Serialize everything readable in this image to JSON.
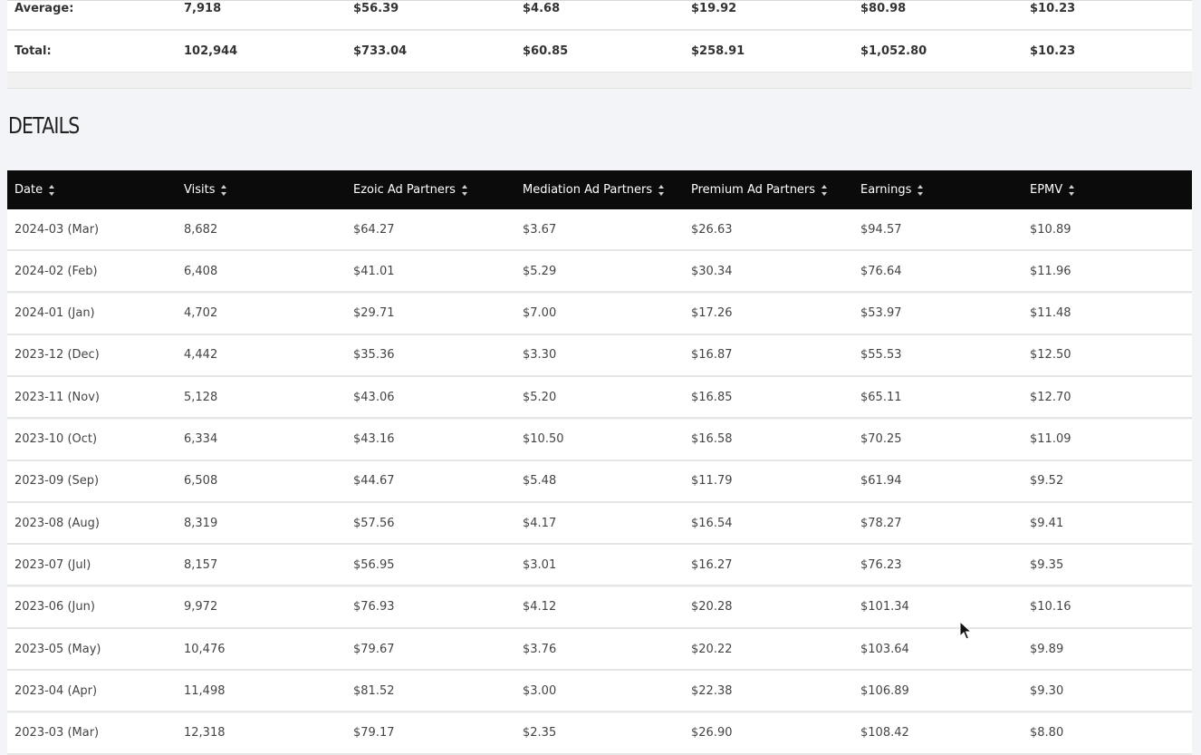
{
  "summary": {
    "average": {
      "label": "Average:",
      "visits": "7,918",
      "ezoic": "$56.39",
      "mediation": "$4.68",
      "premium": "$19.92",
      "earnings": "$80.98",
      "epmv": "$10.23"
    },
    "total": {
      "label": "Total:",
      "visits": "102,944",
      "ezoic": "$733.04",
      "mediation": "$60.85",
      "premium": "$258.91",
      "earnings": "$1,052.80",
      "epmv": "$10.23"
    }
  },
  "details": {
    "title": "DETAILS",
    "headers": {
      "date": "Date",
      "visits": "Visits",
      "ezoic": "Ezoic Ad Partners",
      "mediation": "Mediation Ad Partners",
      "premium": "Premium Ad Partners",
      "earnings": "Earnings",
      "epmv": "EPMV"
    },
    "rows": [
      {
        "date": "2024-03 (Mar)",
        "visits": "8,682",
        "ezoic": "$64.27",
        "mediation": "$3.67",
        "premium": "$26.63",
        "earnings": "$94.57",
        "epmv": "$10.89"
      },
      {
        "date": "2024-02 (Feb)",
        "visits": "6,408",
        "ezoic": "$41.01",
        "mediation": "$5.29",
        "premium": "$30.34",
        "earnings": "$76.64",
        "epmv": "$11.96"
      },
      {
        "date": "2024-01 (Jan)",
        "visits": "4,702",
        "ezoic": "$29.71",
        "mediation": "$7.00",
        "premium": "$17.26",
        "earnings": "$53.97",
        "epmv": "$11.48"
      },
      {
        "date": "2023-12 (Dec)",
        "visits": "4,442",
        "ezoic": "$35.36",
        "mediation": "$3.30",
        "premium": "$16.87",
        "earnings": "$55.53",
        "epmv": "$12.50"
      },
      {
        "date": "2023-11 (Nov)",
        "visits": "5,128",
        "ezoic": "$43.06",
        "mediation": "$5.20",
        "premium": "$16.85",
        "earnings": "$65.11",
        "epmv": "$12.70"
      },
      {
        "date": "2023-10 (Oct)",
        "visits": "6,334",
        "ezoic": "$43.16",
        "mediation": "$10.50",
        "premium": "$16.58",
        "earnings": "$70.25",
        "epmv": "$11.09"
      },
      {
        "date": "2023-09 (Sep)",
        "visits": "6,508",
        "ezoic": "$44.67",
        "mediation": "$5.48",
        "premium": "$11.79",
        "earnings": "$61.94",
        "epmv": "$9.52"
      },
      {
        "date": "2023-08 (Aug)",
        "visits": "8,319",
        "ezoic": "$57.56",
        "mediation": "$4.17",
        "premium": "$16.54",
        "earnings": "$78.27",
        "epmv": "$9.41"
      },
      {
        "date": "2023-07 (Jul)",
        "visits": "8,157",
        "ezoic": "$56.95",
        "mediation": "$3.01",
        "premium": "$16.27",
        "earnings": "$76.23",
        "epmv": "$9.35"
      },
      {
        "date": "2023-06 (Jun)",
        "visits": "9,972",
        "ezoic": "$76.93",
        "mediation": "$4.12",
        "premium": "$20.28",
        "earnings": "$101.34",
        "epmv": "$10.16"
      },
      {
        "date": "2023-05 (May)",
        "visits": "10,476",
        "ezoic": "$79.67",
        "mediation": "$3.76",
        "premium": "$20.22",
        "earnings": "$103.64",
        "epmv": "$9.89"
      },
      {
        "date": "2023-04 (Apr)",
        "visits": "11,498",
        "ezoic": "$81.52",
        "mediation": "$3.00",
        "premium": "$22.38",
        "earnings": "$106.89",
        "epmv": "$9.30"
      },
      {
        "date": "2023-03 (Mar)",
        "visits": "12,318",
        "ezoic": "$79.17",
        "mediation": "$2.35",
        "premium": "$26.90",
        "earnings": "$108.42",
        "epmv": "$8.80"
      }
    ]
  },
  "icons": {
    "sort": "sort-icon",
    "cursor": "mouse-cursor-icon"
  },
  "colors": {
    "header_bg": "#0b0b0c",
    "header_text": "#ffffff",
    "page_bg": "#f3f4f8"
  }
}
